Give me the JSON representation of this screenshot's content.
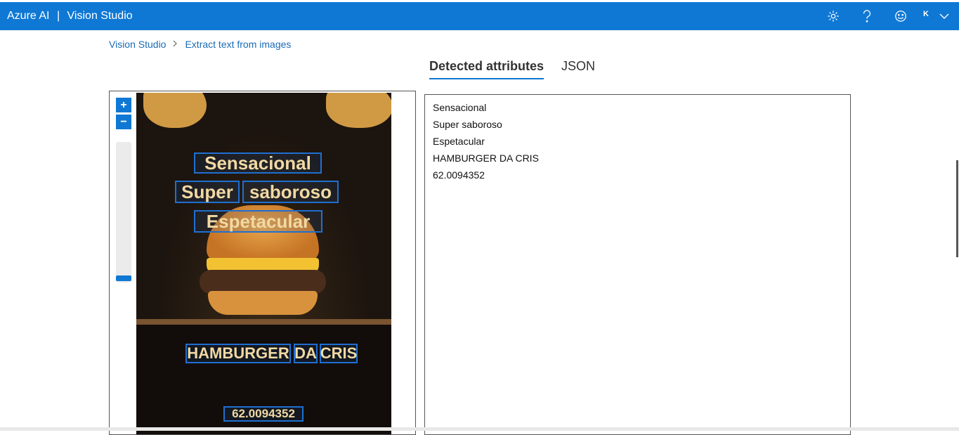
{
  "header": {
    "app_name": "Azure AI",
    "separator": "|",
    "product": "Vision Studio",
    "icons": [
      "gear-icon",
      "help-icon",
      "smiley-icon",
      "chevron-down-icon"
    ],
    "avatar_initial": "K",
    "bar_color": "#0f78d4"
  },
  "breadcrumb": {
    "root": "Vision Studio",
    "sep": ">",
    "current": "Extract text from images"
  },
  "tabs": [
    {
      "label": "Detected attributes",
      "active": true
    },
    {
      "label": "JSON",
      "active": false
    }
  ],
  "image_viewer": {
    "zoom_in": "+",
    "zoom_out": "−",
    "detections": [
      {
        "text": "Sensacional"
      },
      {
        "text": "Super"
      },
      {
        "text": "saboroso"
      },
      {
        "text": "Espetacular"
      },
      {
        "text": "HAMBURGER"
      },
      {
        "text": "DA"
      },
      {
        "text": "CRIS"
      },
      {
        "text": "62.0094352"
      }
    ]
  },
  "results": {
    "lines": [
      "Sensacional",
      "Super saboroso",
      "Espetacular",
      "HAMBURGER DA CRIS",
      "62.0094352"
    ]
  }
}
